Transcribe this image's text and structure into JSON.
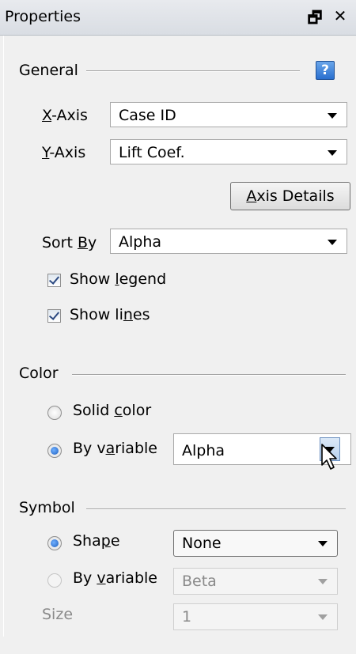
{
  "window": {
    "title": "Properties",
    "pin_glyph": "🗗",
    "close_glyph": "✕"
  },
  "general": {
    "section_label": "General",
    "help_glyph": "?",
    "x_axis": {
      "label_u": "X",
      "label_rest": "-Axis",
      "value": "Case ID"
    },
    "y_axis": {
      "label_u": "Y",
      "label_rest": "-Axis",
      "value": "Lift Coef."
    },
    "axis_details": {
      "label_u": "A",
      "label_rest": "xis Details"
    },
    "sort_by": {
      "label_pre": "Sort ",
      "label_u": "B",
      "label_rest": "y",
      "value": "Alpha"
    },
    "show_legend": {
      "label_pre": "Show ",
      "label_u": "l",
      "label_rest": "egend",
      "checked": true
    },
    "show_lines": {
      "label_pre": "Show li",
      "label_u": "n",
      "label_rest": "es",
      "checked": true
    }
  },
  "color": {
    "section_label": "Color",
    "solid": {
      "label_pre": "Solid ",
      "label_u": "c",
      "label_rest": "olor",
      "selected": false
    },
    "by_variable": {
      "label_pre": "By v",
      "label_u": "a",
      "label_rest": "riable",
      "selected": true,
      "value": "Alpha"
    }
  },
  "symbol": {
    "section_label": "Symbol",
    "shape": {
      "label_pre": "Sha",
      "label_u": "p",
      "label_rest": "e",
      "selected": true,
      "value": "None"
    },
    "by_variable": {
      "label_pre": "By ",
      "label_u": "v",
      "label_rest": "ariable",
      "selected": false,
      "value": "Beta"
    },
    "size": {
      "label": "Size",
      "value": "1"
    }
  }
}
